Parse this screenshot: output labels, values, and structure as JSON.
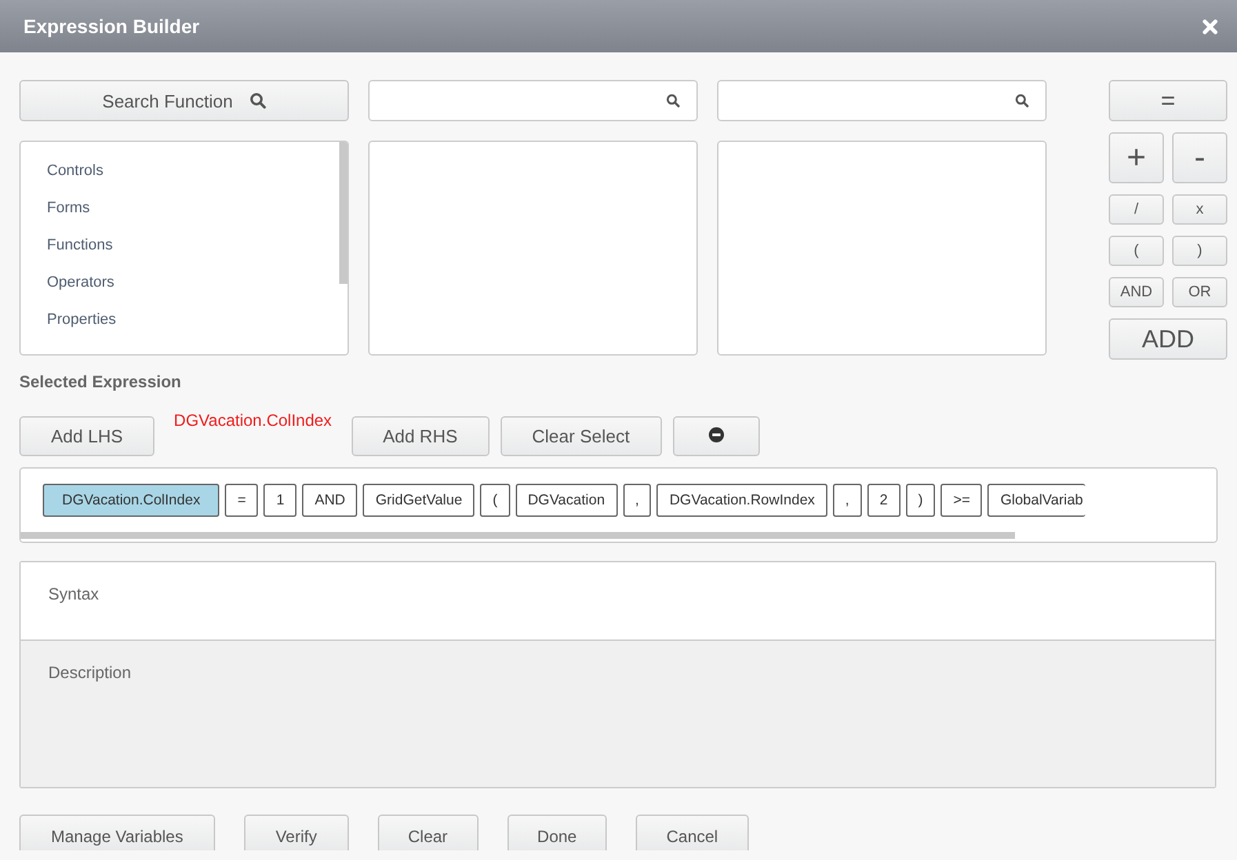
{
  "window": {
    "title": "Expression Builder"
  },
  "search_button": {
    "label": "Search Function"
  },
  "category_list": {
    "items": [
      "Controls",
      "Forms",
      "Functions",
      "Operators",
      "Properties"
    ]
  },
  "operators": [
    {
      "label": "=",
      "kind": "wide"
    },
    {
      "label": "+",
      "kind": "big"
    },
    {
      "label": "-",
      "kind": "big"
    },
    {
      "label": "/",
      "kind": "small"
    },
    {
      "label": "x",
      "kind": "small"
    },
    {
      "label": "(",
      "kind": "small"
    },
    {
      "label": ")",
      "kind": "small"
    },
    {
      "label": "AND",
      "kind": "small"
    },
    {
      "label": "OR",
      "kind": "small"
    },
    {
      "label": "ADD",
      "kind": "wide"
    }
  ],
  "selected_expression": {
    "label": "Selected Expression",
    "add_lhs": "Add LHS",
    "lhs_value": "DGVacation.ColIndex",
    "add_rhs": "Add RHS",
    "clear_select": "Clear Select"
  },
  "tokens": [
    {
      "text": "DGVacation.ColIndex",
      "selected": true
    },
    {
      "text": "=",
      "selected": false
    },
    {
      "text": "1",
      "selected": false
    },
    {
      "text": "AND",
      "selected": false
    },
    {
      "text": "GridGetValue",
      "selected": false
    },
    {
      "text": "(",
      "selected": false
    },
    {
      "text": "DGVacation",
      "selected": false
    },
    {
      "text": ",",
      "selected": false
    },
    {
      "text": "DGVacation.RowIndex",
      "selected": false
    },
    {
      "text": ",",
      "selected": false
    },
    {
      "text": "2",
      "selected": false
    },
    {
      "text": ")",
      "selected": false
    },
    {
      "text": ">=",
      "selected": false
    },
    {
      "text": "GlobalVariab",
      "selected": false
    }
  ],
  "syntax": {
    "label": "Syntax"
  },
  "description": {
    "label": "Description"
  },
  "footer_buttons": [
    "Manage Variables",
    "Verify",
    "Clear",
    "Done",
    "Cancel"
  ]
}
